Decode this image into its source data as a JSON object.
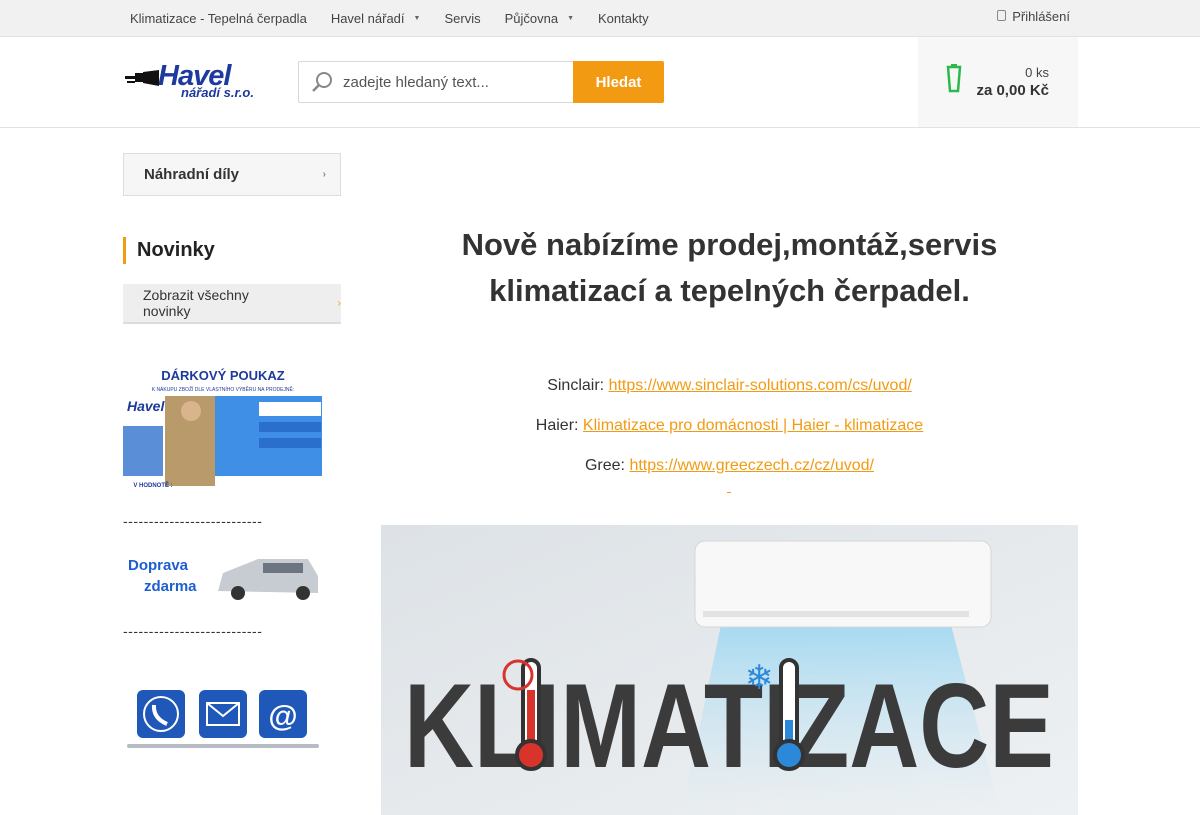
{
  "topnav": {
    "items": [
      {
        "label": "Klimatizace - Tepelná čerpadla",
        "has_caret": false
      },
      {
        "label": "Havel nářadí",
        "has_caret": true
      },
      {
        "label": "Servis",
        "has_caret": false
      },
      {
        "label": "Půjčovna",
        "has_caret": true
      },
      {
        "label": "Kontakty",
        "has_caret": false
      }
    ],
    "login_label": "Přihlášení"
  },
  "header": {
    "logo": {
      "brand": "Havel",
      "sub": "nářadí s.r.o."
    },
    "search": {
      "placeholder": "zadejte hledaný text...",
      "button_label": "Hledat"
    },
    "cart": {
      "qty": "0 ks",
      "total": "za 0,00 Kč"
    }
  },
  "sidebar": {
    "category_label": "Náhradní díly",
    "news_heading": "Novinky",
    "all_news_label": "Zobrazit všechny novinky",
    "divider_text": "---------------------------",
    "voucher": {
      "title": "DÁRKOVÝ POUKAZ",
      "line": "K NÁKUPU ZBOŽÍ DLE VLASTNÍHO VÝBĚRU NA PRODEJNĚ:",
      "hodnota": "V HODNOTĚ :"
    },
    "doprava": {
      "line1": "Doprava",
      "line2": "zdarma"
    }
  },
  "main": {
    "headline_line1": "Nově nabízíme prodej,montáž,servis",
    "headline_line2": "klimatizací a tepelných čerpadel.",
    "brands": [
      {
        "label": "Sinclair:",
        "link": "https://www.sinclair-solutions.com/cs/uvod/"
      },
      {
        "label": "Haier:",
        "link": "Klimatizace pro domácnosti | Haier - klimatizace"
      },
      {
        "label": "Gree:",
        "link": "https://www.greeczech.cz/cz/uvod/"
      }
    ],
    "banner_text": "KLIMATIZACE"
  },
  "colors": {
    "accent": "#f39a13",
    "brand_blue": "#1d3a9c",
    "cart_green": "#2db84b"
  }
}
